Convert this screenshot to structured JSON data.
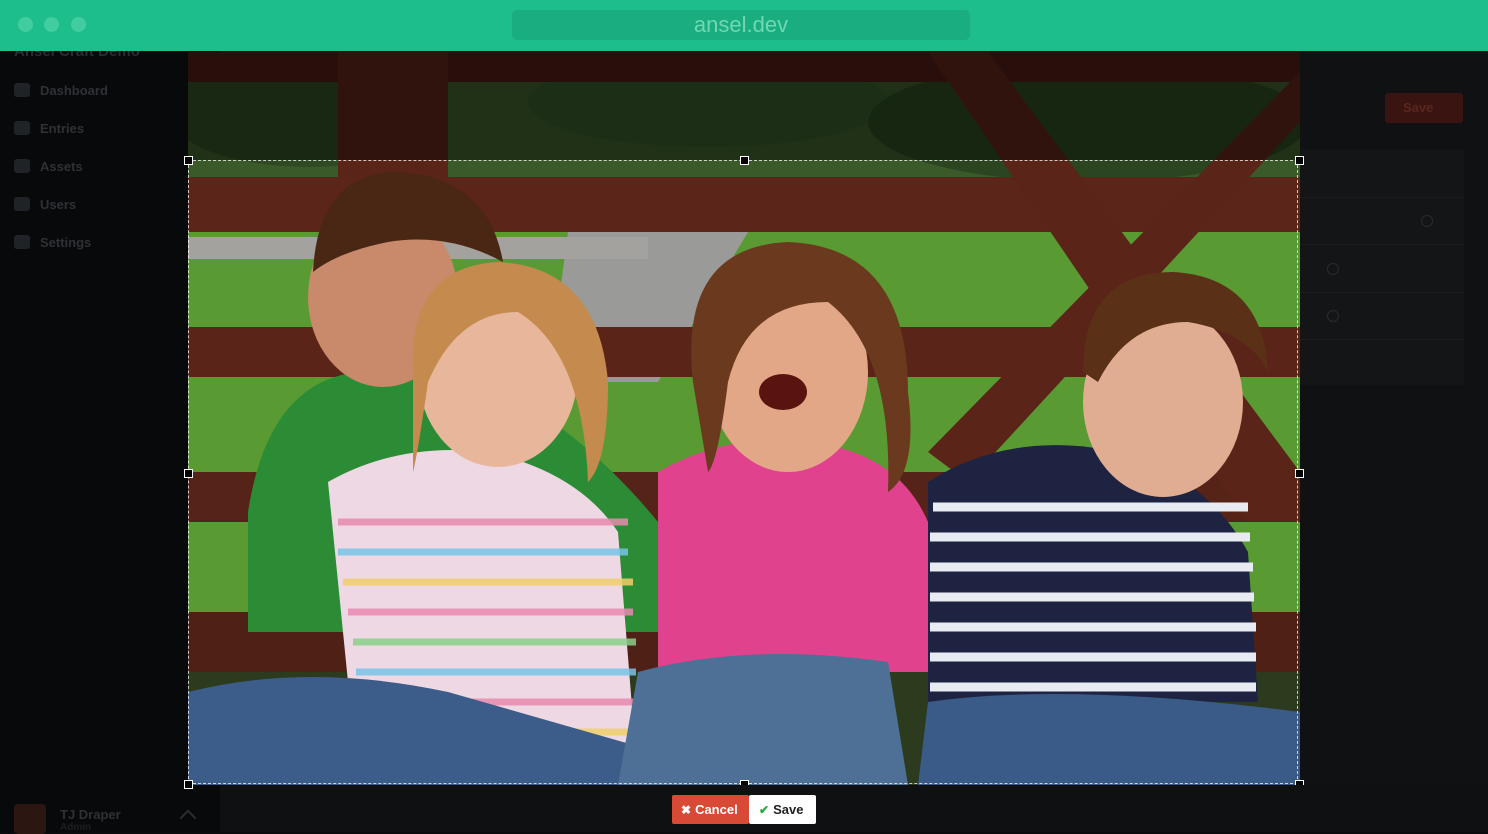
{
  "browser": {
    "url": "ansel.dev"
  },
  "sidebar": {
    "site_name": "Ansel Craft Demo",
    "items": [
      {
        "label": "Dashboard",
        "icon": "dashboard-icon"
      },
      {
        "label": "Entries",
        "icon": "entries-icon"
      },
      {
        "label": "Assets",
        "icon": "assets-icon"
      },
      {
        "label": "Users",
        "icon": "users-icon"
      },
      {
        "label": "Settings",
        "icon": "gear-icon"
      }
    ],
    "user": {
      "name": "TJ Draper",
      "role": "Admin"
    }
  },
  "page": {
    "save_label": "Save"
  },
  "editor": {
    "cancel_label": "Cancel",
    "save_label": "Save",
    "cancel_icon": "close-icon",
    "save_icon": "check-icon"
  },
  "colors": {
    "chrome": "#1ebd8c",
    "cancel": "#d84a36",
    "save_check": "#29a93b"
  }
}
